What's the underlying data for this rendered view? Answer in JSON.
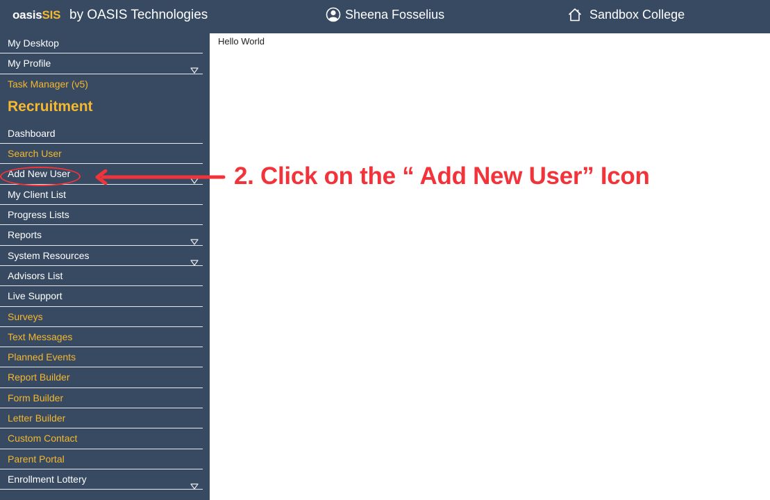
{
  "header": {
    "brand_prefix": "oasis",
    "brand_suffix": "SIS",
    "brand_by": "by OASIS Technologies",
    "user_icon": "user-circle-icon",
    "user_name": "Sheena Fosselius",
    "college_icon": "home-icon",
    "college_name": "Sandbox College"
  },
  "sidebar": {
    "top_items": [
      {
        "label": "My Desktop",
        "color": "white",
        "has_dropdown": false
      },
      {
        "label": "My Profile",
        "color": "white",
        "has_dropdown": true
      },
      {
        "label": "Task Manager (v5)",
        "color": "gold",
        "has_dropdown": false
      }
    ],
    "section_title": "Recruitment",
    "items": [
      {
        "label": "Dashboard",
        "color": "white",
        "has_dropdown": false
      },
      {
        "label": "Search User",
        "color": "gold",
        "has_dropdown": false
      },
      {
        "label": "Add New User",
        "color": "white",
        "has_dropdown": true
      },
      {
        "label": "My Client List",
        "color": "white",
        "has_dropdown": false
      },
      {
        "label": "Progress Lists",
        "color": "white",
        "has_dropdown": false
      },
      {
        "label": "Reports",
        "color": "white",
        "has_dropdown": true
      },
      {
        "label": "System Resources",
        "color": "white",
        "has_dropdown": true
      },
      {
        "label": "Advisors List",
        "color": "white",
        "has_dropdown": false
      },
      {
        "label": "Live Support",
        "color": "white",
        "has_dropdown": false
      },
      {
        "label": "Surveys",
        "color": "gold",
        "has_dropdown": false
      },
      {
        "label": "Text Messages",
        "color": "gold",
        "has_dropdown": false
      },
      {
        "label": "Planned Events",
        "color": "gold",
        "has_dropdown": false
      },
      {
        "label": "Report Builder",
        "color": "gold",
        "has_dropdown": false
      },
      {
        "label": "Form Builder",
        "color": "gold",
        "has_dropdown": false
      },
      {
        "label": "Letter Builder",
        "color": "gold",
        "has_dropdown": false
      },
      {
        "label": "Custom Contact",
        "color": "gold",
        "has_dropdown": false
      },
      {
        "label": "Parent Portal",
        "color": "gold",
        "has_dropdown": false
      },
      {
        "label": "Enrollment Lottery",
        "color": "white",
        "has_dropdown": true
      }
    ]
  },
  "content": {
    "text": "Hello World"
  },
  "annotation": {
    "text": "2. Click on the “ Add New User” Icon",
    "target": "Add New User",
    "color": "#f3333a"
  },
  "colors": {
    "nav_bg": "#374a62",
    "accent_gold": "#f5b82e"
  }
}
